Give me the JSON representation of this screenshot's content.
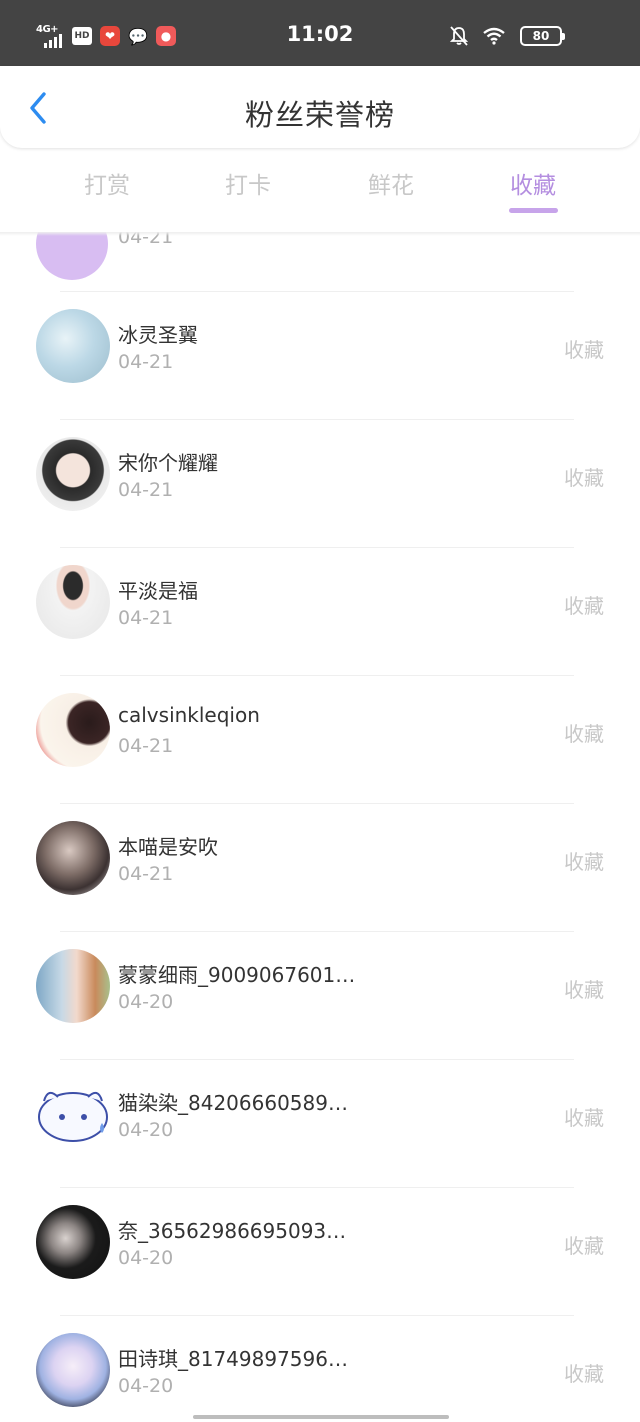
{
  "status_bar": {
    "network": "4G+",
    "hd": "HD",
    "time": "11:02",
    "battery": "80"
  },
  "header": {
    "title": "粉丝荣誉榜"
  },
  "tabs": [
    {
      "label": "打赏",
      "active": false
    },
    {
      "label": "打卡",
      "active": false
    },
    {
      "label": "鲜花",
      "active": false
    },
    {
      "label": "收藏",
      "active": true
    }
  ],
  "partial_row": {
    "date": "04-21"
  },
  "fans": [
    {
      "name": "冰灵圣翼",
      "date": "04-21",
      "action": "收藏"
    },
    {
      "name": "宋你个耀耀",
      "date": "04-21",
      "action": "收藏"
    },
    {
      "name": "平淡是福",
      "date": "04-21",
      "action": "收藏"
    },
    {
      "name": "calvsinkleqion",
      "date": "04-21",
      "action": "收藏"
    },
    {
      "name": "本喵是安吹",
      "date": "04-21",
      "action": "收藏"
    },
    {
      "name": "蒙蒙细雨_9009067601…",
      "date": "04-20",
      "action": "收藏"
    },
    {
      "name": "猫染染_84206660589…",
      "date": "04-20",
      "action": "收藏"
    },
    {
      "name": "奈_36562986695093…",
      "date": "04-20",
      "action": "收藏"
    },
    {
      "name": "田诗琪_81749897596…",
      "date": "04-20",
      "action": "收藏"
    }
  ],
  "colors": {
    "accent": "#b48ee0",
    "status_bar": "#444444",
    "back_arrow": "#2d8cf0"
  }
}
